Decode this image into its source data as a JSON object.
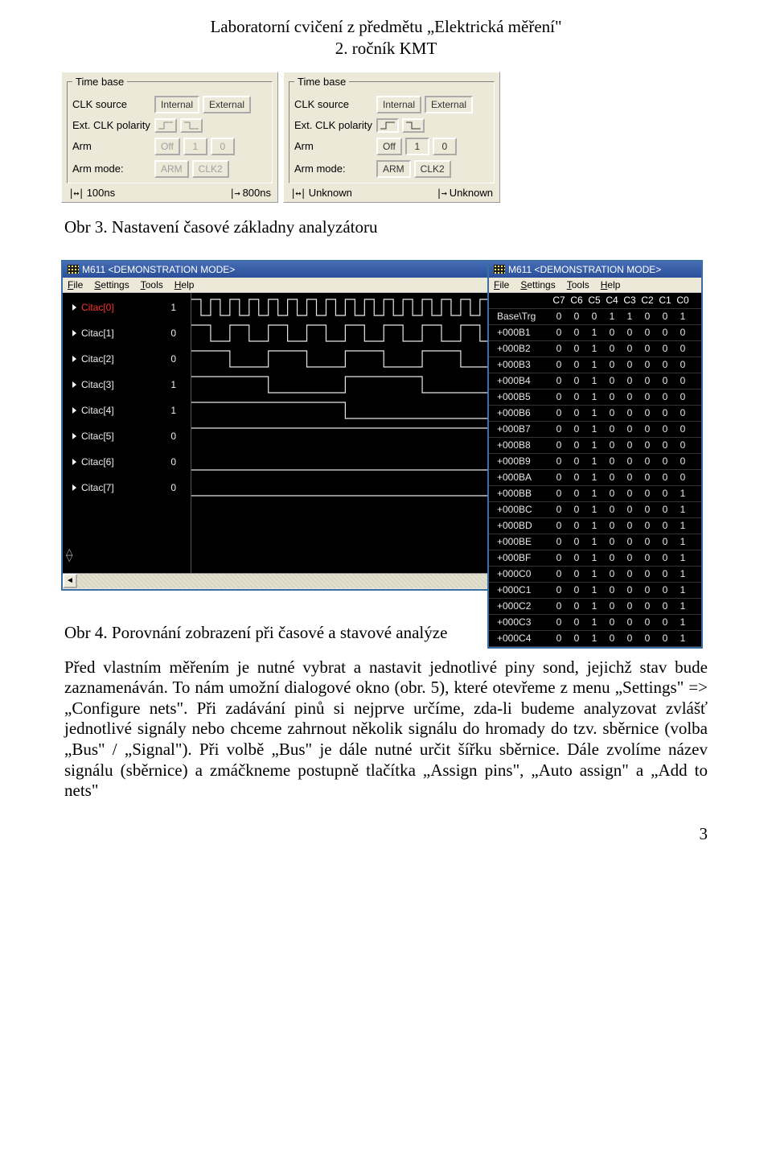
{
  "doc_header_line1": "Laboratorní cvičení z předmětu „Elektrická měření\"",
  "doc_header_line2": "2. ročník KMT",
  "timebase": {
    "legend": "Time base",
    "rows": {
      "clk": "CLK source",
      "pol": "Ext. CLK polarity",
      "arm": "Arm",
      "mode": "Arm mode:"
    },
    "btn_internal": "Internal",
    "btn_external": "External",
    "btn_off": "Off",
    "btn_1": "1",
    "btn_0": "0",
    "btn_arm": "ARM",
    "btn_clk2": "CLK2",
    "left_bottom_a": "100ns",
    "left_bottom_b": "800ns",
    "right_bottom_a": "Unknown",
    "right_bottom_b": "Unknown"
  },
  "caption1": "Obr 3. Nastavení časové základny analyzátoru",
  "wave": {
    "title": "M611 <DEMONSTRATION MODE>",
    "menu": {
      "file": "File",
      "settings": "Settings",
      "tools": "Tools",
      "help": "Help"
    },
    "rows": [
      {
        "name": "Citac[0]",
        "val": "1"
      },
      {
        "name": "Citac[1]",
        "val": "0"
      },
      {
        "name": "Citac[2]",
        "val": "0"
      },
      {
        "name": "Citac[3]",
        "val": "1"
      },
      {
        "name": "Citac[4]",
        "val": "1"
      },
      {
        "name": "Citac[5]",
        "val": "0"
      },
      {
        "name": "Citac[6]",
        "val": "0"
      },
      {
        "name": "Citac[7]",
        "val": "0"
      }
    ]
  },
  "state": {
    "title": "M611 <DEMONSTRATION MODE>",
    "menu": {
      "file": "File",
      "settings": "Settings",
      "tools": "Tools",
      "help": "Help"
    },
    "cols": [
      "C7",
      "C6",
      "C5",
      "C4",
      "C3",
      "C2",
      "C1",
      "C0"
    ],
    "rows": [
      {
        "addr": "Base\\Trg",
        "bits": [
          "0",
          "0",
          "0",
          "1",
          "1",
          "0",
          "0",
          "1"
        ]
      },
      {
        "addr": "+000B1",
        "bits": [
          "0",
          "0",
          "1",
          "0",
          "0",
          "0",
          "0",
          "0"
        ]
      },
      {
        "addr": "+000B2",
        "bits": [
          "0",
          "0",
          "1",
          "0",
          "0",
          "0",
          "0",
          "0"
        ]
      },
      {
        "addr": "+000B3",
        "bits": [
          "0",
          "0",
          "1",
          "0",
          "0",
          "0",
          "0",
          "0"
        ]
      },
      {
        "addr": "+000B4",
        "bits": [
          "0",
          "0",
          "1",
          "0",
          "0",
          "0",
          "0",
          "0"
        ]
      },
      {
        "addr": "+000B5",
        "bits": [
          "0",
          "0",
          "1",
          "0",
          "0",
          "0",
          "0",
          "0"
        ]
      },
      {
        "addr": "+000B6",
        "bits": [
          "0",
          "0",
          "1",
          "0",
          "0",
          "0",
          "0",
          "0"
        ]
      },
      {
        "addr": "+000B7",
        "bits": [
          "0",
          "0",
          "1",
          "0",
          "0",
          "0",
          "0",
          "0"
        ]
      },
      {
        "addr": "+000B8",
        "bits": [
          "0",
          "0",
          "1",
          "0",
          "0",
          "0",
          "0",
          "0"
        ]
      },
      {
        "addr": "+000B9",
        "bits": [
          "0",
          "0",
          "1",
          "0",
          "0",
          "0",
          "0",
          "0"
        ]
      },
      {
        "addr": "+000BA",
        "bits": [
          "0",
          "0",
          "1",
          "0",
          "0",
          "0",
          "0",
          "0"
        ]
      },
      {
        "addr": "+000BB",
        "bits": [
          "0",
          "0",
          "1",
          "0",
          "0",
          "0",
          "0",
          "1"
        ]
      },
      {
        "addr": "+000BC",
        "bits": [
          "0",
          "0",
          "1",
          "0",
          "0",
          "0",
          "0",
          "1"
        ]
      },
      {
        "addr": "+000BD",
        "bits": [
          "0",
          "0",
          "1",
          "0",
          "0",
          "0",
          "0",
          "1"
        ]
      },
      {
        "addr": "+000BE",
        "bits": [
          "0",
          "0",
          "1",
          "0",
          "0",
          "0",
          "0",
          "1"
        ]
      },
      {
        "addr": "+000BF",
        "bits": [
          "0",
          "0",
          "1",
          "0",
          "0",
          "0",
          "0",
          "1"
        ]
      },
      {
        "addr": "+000C0",
        "bits": [
          "0",
          "0",
          "1",
          "0",
          "0",
          "0",
          "0",
          "1"
        ]
      },
      {
        "addr": "+000C1",
        "bits": [
          "0",
          "0",
          "1",
          "0",
          "0",
          "0",
          "0",
          "1"
        ]
      },
      {
        "addr": "+000C2",
        "bits": [
          "0",
          "0",
          "1",
          "0",
          "0",
          "0",
          "0",
          "1"
        ]
      },
      {
        "addr": "+000C3",
        "bits": [
          "0",
          "0",
          "1",
          "0",
          "0",
          "0",
          "0",
          "1"
        ]
      },
      {
        "addr": "+000C4",
        "bits": [
          "0",
          "0",
          "1",
          "0",
          "0",
          "0",
          "0",
          "1"
        ]
      }
    ]
  },
  "caption2": "Obr 4. Porovnání zobrazení při časové a stavové analýze",
  "para1": "Před vlastním měřením je nutné vybrat a nastavit jednotlivé piny sond, jejichž stav bude zaznamenáván. To nám umožní dialogové okno (obr. 5), které otevřeme z menu „Settings\" => „Configure nets\". Při zadávání pinů si nejprve určíme, zda-li budeme analyzovat zvlášť jednotlivé signály nebo chceme zahrnout několik signálu do hromady do tzv. sběrnice (volba „Bus\" / „Signal\"). Při volbě „Bus\" je dále nutné určit šířku sběrnice. Dále zvolíme název signálu (sběrnice) a zmáčkneme postupně tlačítka „Assign pins\", „Auto assign\" a „Add to nets\"",
  "page_number": "3"
}
